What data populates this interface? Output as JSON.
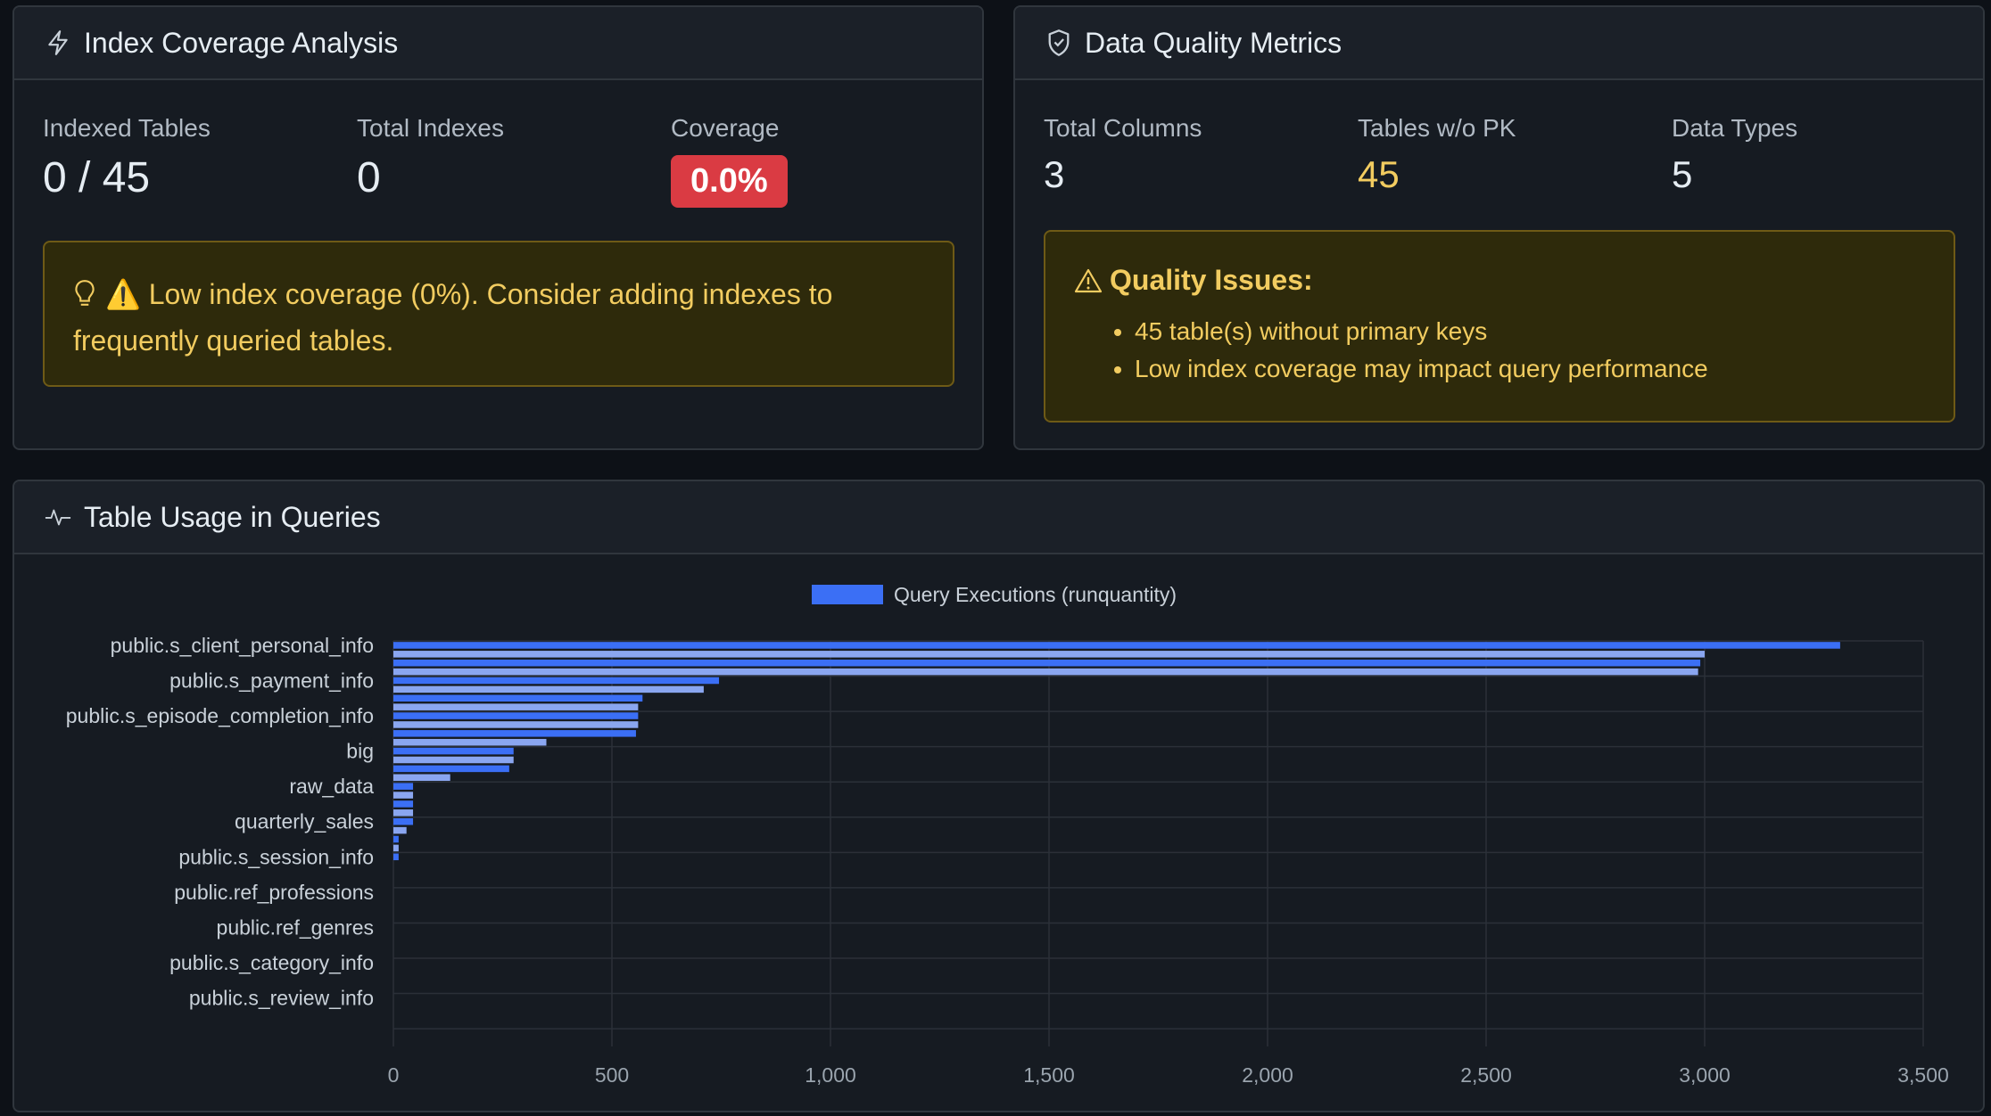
{
  "index_card": {
    "title": "Index Coverage Analysis",
    "icon": "lightning-icon",
    "metrics": [
      {
        "label": "Indexed Tables",
        "value": "0 / 45"
      },
      {
        "label": "Total Indexes",
        "value": "0"
      },
      {
        "label": "Coverage",
        "value": "0.0%"
      }
    ],
    "alert": "⚠️ Low index coverage (0%). Consider adding indexes to frequently queried tables.",
    "alert_icon": "lightbulb-icon",
    "coverage_badge_color": "#da3b43"
  },
  "quality_card": {
    "title": "Data Quality Metrics",
    "icon": "shield-check-icon",
    "metrics": [
      {
        "label": "Total Columns",
        "value": "3"
      },
      {
        "label": "Tables w/o PK",
        "value": "45"
      },
      {
        "label": "Data Types",
        "value": "5"
      }
    ],
    "issues_title": "Quality Issues:",
    "issues": [
      "45 table(s) without primary keys",
      "Low index coverage may impact query performance"
    ],
    "warning_color": "#f2cc60"
  },
  "usage_card": {
    "title": "Table Usage in Queries",
    "icon": "activity-icon"
  },
  "chart_data": {
    "type": "bar",
    "orientation": "horizontal",
    "legend": "Query Executions (runquantity)",
    "legend_placement": "top-center",
    "labeled_categories": [
      "public.s_client_personal_info",
      "public.s_payment_info",
      "public.s_episode_completion_info",
      "big",
      "raw_data",
      "quarterly_sales",
      "public.s_session_info",
      "public.ref_professions",
      "public.ref_genres",
      "public.s_category_info",
      "public.s_review_info"
    ],
    "values": [
      3310,
      3000,
      2990,
      2985,
      745,
      710,
      570,
      560,
      560,
      560,
      555,
      350,
      275,
      275,
      265,
      130,
      45,
      45,
      45,
      45,
      45,
      30,
      12,
      12,
      12,
      0,
      0,
      0,
      0,
      0,
      0,
      0,
      0,
      0,
      0,
      0,
      0,
      0,
      0,
      0,
      0,
      0,
      0,
      0,
      0
    ],
    "xlim": [
      0,
      3500
    ],
    "xticks": [
      "0",
      "500",
      "1,000",
      "1,500",
      "2,000",
      "2,500",
      "3,000",
      "3,500"
    ],
    "grid": true,
    "bar_color": "#3b6ff5",
    "bar_color_alt": "#8aa6f0"
  }
}
